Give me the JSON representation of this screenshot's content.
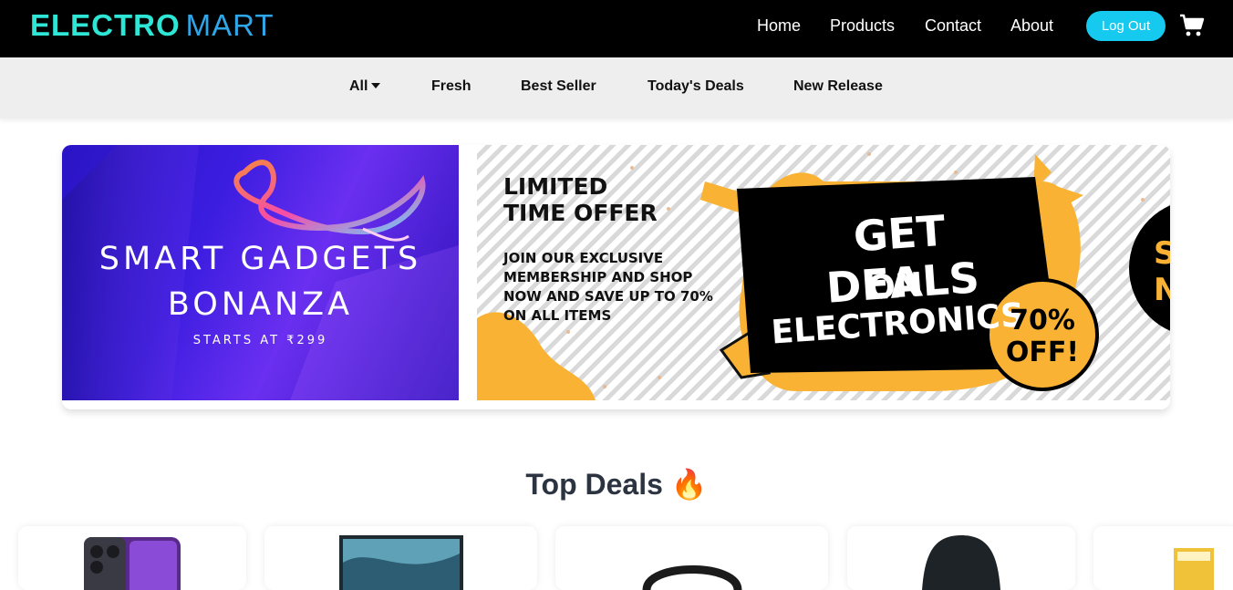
{
  "brand": {
    "part1": "ELECTRO",
    "part2": "MART"
  },
  "nav": {
    "links": [
      "Home",
      "Products",
      "Contact",
      "About"
    ],
    "logout_label": "Log Out",
    "cart_icon": "cart-icon"
  },
  "categories": [
    "All",
    "Fresh",
    "Best Seller",
    "Today's Deals",
    "New Release"
  ],
  "carousel": {
    "slide1": {
      "title_line1": "SMART GADGETS",
      "title_line2": "BONANZA",
      "subtitle": "STARTS AT ₹299"
    },
    "slide2": {
      "headline_line1": "LIMITED",
      "headline_line2": "TIME OFFER",
      "body_line1": "JOIN OUR EXCLUSIVE",
      "body_line2": "MEMBERSHIP AND SHOP",
      "body_line3": "NOW AND SAVE UP TO 70%",
      "body_line4": "ON ALL ITEMS",
      "deal_line1": "GET DEALS",
      "deal_line2": "ON ELECTRONICS",
      "badge_line1": "70%",
      "badge_line2": "OFF!"
    }
  },
  "top_deals": {
    "title": "Top Deals 🔥"
  },
  "products": [
    {
      "image": "smartphone-image"
    },
    {
      "image": "laptop-image"
    },
    {
      "image": "headphones-image"
    },
    {
      "image": "smartwatch-image"
    },
    {
      "image": "tv-image"
    }
  ],
  "colors": {
    "navbar": "#000000",
    "brand_primary": "#2ee6d6",
    "brand_secondary": "#2fa6e8",
    "logout": "#16c9ef",
    "category_bar": "#eeeeee",
    "accent_yellow": "#f9b233"
  }
}
